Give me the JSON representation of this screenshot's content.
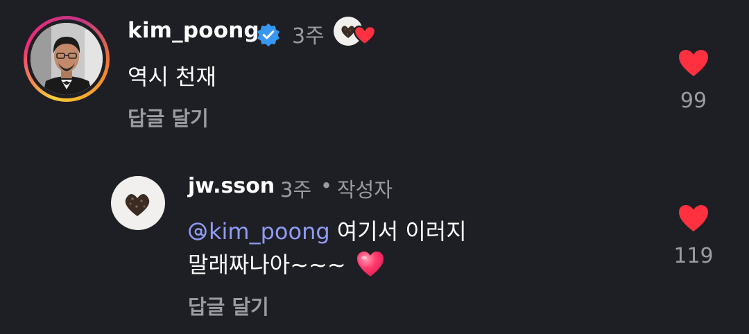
{
  "comments": [
    {
      "username": "kim_poong",
      "verified": true,
      "time": "3주",
      "text": "역시 천재",
      "reply_label": "답글 달기",
      "like_count": "99",
      "liked_by_creator": true
    }
  ],
  "reply": {
    "username": "jw.sson",
    "time": "3주",
    "separator": "•",
    "author_badge": "작성자",
    "mention": "kim_poong",
    "text_after_mention": " 여기서 이러지",
    "text_line2": "말래짜나아~~~",
    "emoji": "heart-emoji",
    "reply_label": "답글 달기",
    "like_count": "119"
  },
  "colors": {
    "background": "#1e1f24",
    "secondary_text": "#9a9ca3",
    "mention": "#8f9cf3",
    "like_heart": "#ff3040",
    "verified_badge": "#3897f0"
  }
}
